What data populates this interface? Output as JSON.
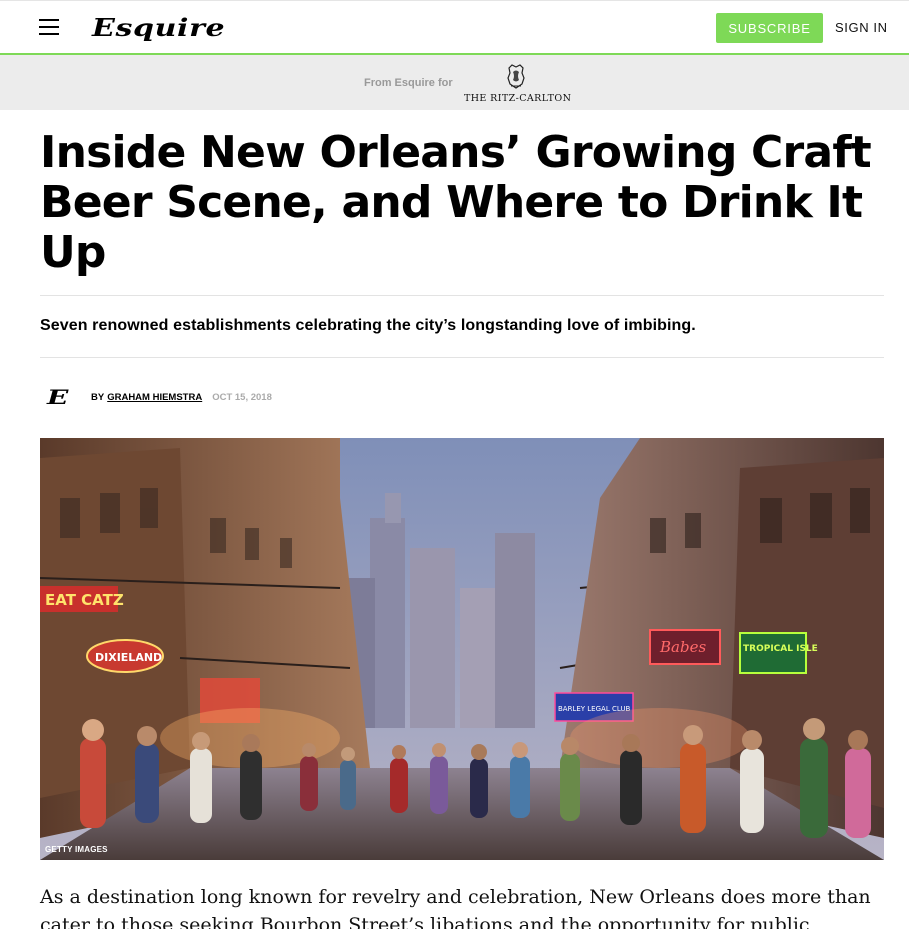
{
  "header": {
    "logo": "Esquire",
    "subscribe_label": "SUBSCRIBE",
    "signin_label": "SIGN IN"
  },
  "sponsor": {
    "label": "From Esquire for",
    "brand": "THE RITZ-CARLTON"
  },
  "article": {
    "headline": "Inside New Orleans’ Growing Craft Beer Scene, and Where to Drink It Up",
    "dek": "Seven renowned establishments celebrating the city’s longstanding love of imbibing.",
    "byline_logo": "E",
    "by": "BY",
    "author": "GRAHAM HIEMSTRA",
    "date": "OCT 15, 2018",
    "image_credit": "GETTY IMAGES",
    "body": "As a destination long known for revelry and celebration, New Orleans does more than cater to those seeking Bourbon Street’s libations and the opportunity for public consumption. The historic city has"
  },
  "signs": {
    "sign1": "EAT CATZ",
    "sign2": "DIXIELAND",
    "sign3": "Babes",
    "sign4": "TROPICAL ISLE",
    "sign5": "BARLEY LEGAL CLUB"
  },
  "colors": {
    "accent": "#7ed957",
    "sponsor_bg": "#ececec"
  }
}
